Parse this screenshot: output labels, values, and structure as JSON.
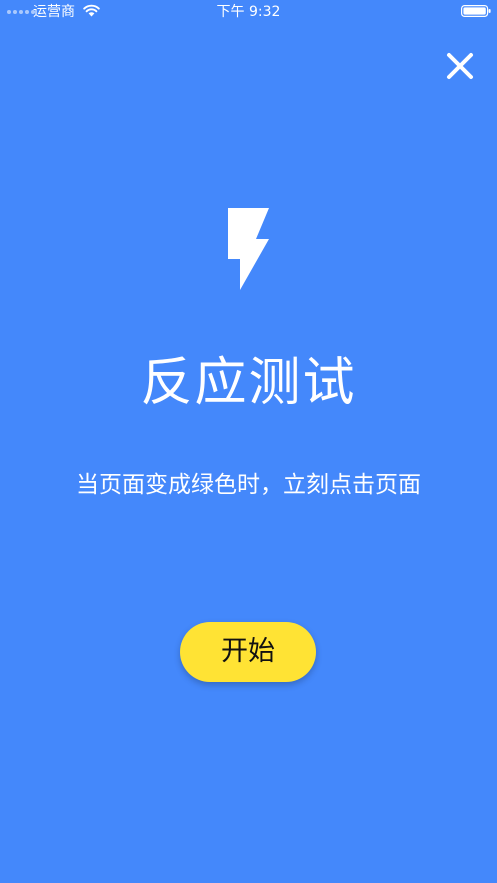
{
  "status_bar": {
    "carrier": "运营商",
    "time": "下午 9:32"
  },
  "header": {
    "close_icon": "close-icon"
  },
  "main": {
    "hero_icon": "lightning-bolt-icon",
    "title": "反应测试",
    "subtitle": "当页面变成绿色时，立刻点击页面",
    "start_label": "开始"
  },
  "colors": {
    "background": "#4488FB",
    "button": "#FFE334",
    "text": "#FFFFFF",
    "button_text": "#111111"
  }
}
